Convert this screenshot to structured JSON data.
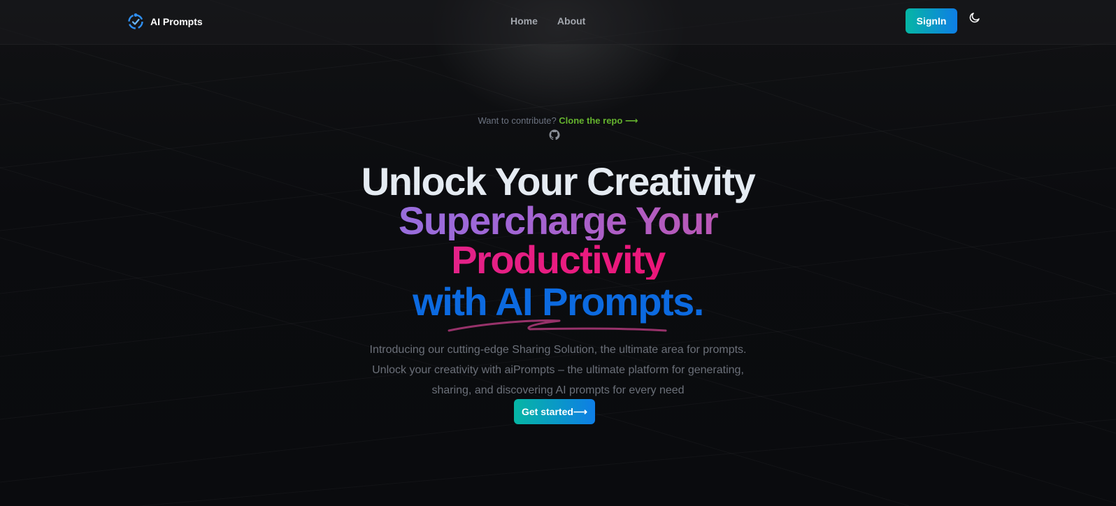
{
  "header": {
    "brand": "AI Prompts",
    "nav": [
      {
        "label": "Home"
      },
      {
        "label": "About"
      }
    ],
    "signin_label": "SignIn"
  },
  "hero": {
    "contribute_text": "Want to contribute? ",
    "contribute_link": "Clone the repo ⟶",
    "headline": {
      "line1": "Unlock Your Creativity",
      "line2": "Supercharge Your",
      "line3": "Productivity",
      "line4": "with AI Prompts."
    },
    "intro_lines": [
      "Introducing our cutting-edge Sharing Solution, the ultimate area for prompts.",
      "Unlock your creativity with aiPrompts – the ultimate platform for generating,",
      "sharing, and discovering AI prompts for every need"
    ],
    "cta_label": "Get started⟶"
  },
  "colors": {
    "background": "#0a0b0e",
    "accent_gradient_start": "#06b6a4",
    "accent_gradient_end": "#0e7ee6",
    "contribute_link": "#65b32e",
    "headline_line4": "#0c6ae0"
  },
  "icons": {
    "logo": "ai-prompts-logo-icon",
    "theme": "moon-icon",
    "repo": "github-icon"
  }
}
